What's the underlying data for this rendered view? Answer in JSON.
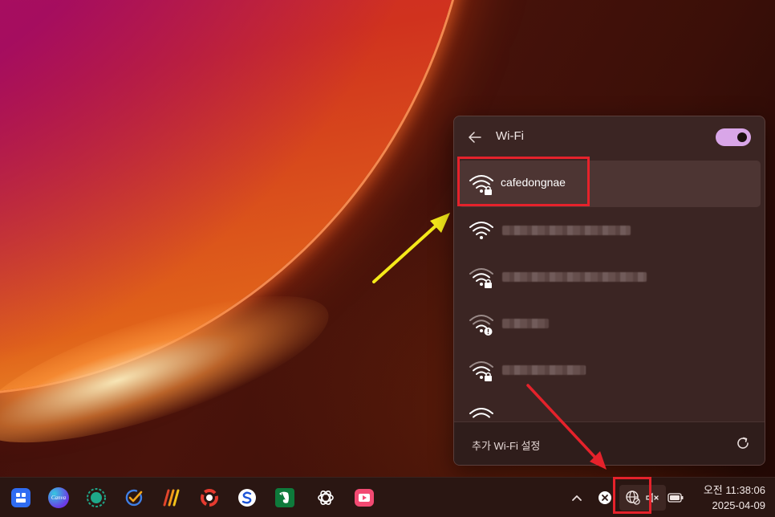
{
  "wifi_panel": {
    "title": "Wi-Fi",
    "toggle_state": "on",
    "networks": [
      {
        "name": "cafedongnae",
        "secured": true,
        "selected": true
      },
      {
        "name": "",
        "secured": false,
        "selected": false
      },
      {
        "name": "",
        "secured": true,
        "selected": false
      },
      {
        "name": "",
        "secured": true,
        "warning": true,
        "selected": false
      },
      {
        "name": "",
        "secured": true,
        "selected": false
      }
    ],
    "more_settings_label": "추가 Wi-Fi 설정"
  },
  "taskbar": {
    "apps": [
      "widgets-app",
      "canva-app",
      "screen-recorder-app",
      "task-checker-app",
      "vivaldi-app",
      "daum-app",
      "simplenote-app",
      "evernote-app",
      "chatgpt-app",
      "video-editor-app"
    ],
    "canva_label": "Canva",
    "clock": {
      "time": "오전 11:38:06",
      "date": "2025-04-09"
    }
  },
  "colors": {
    "accent_toggle": "#d9a6e8",
    "annotation_red": "#e5222b",
    "annotation_yellow": "#f5ea1a"
  }
}
